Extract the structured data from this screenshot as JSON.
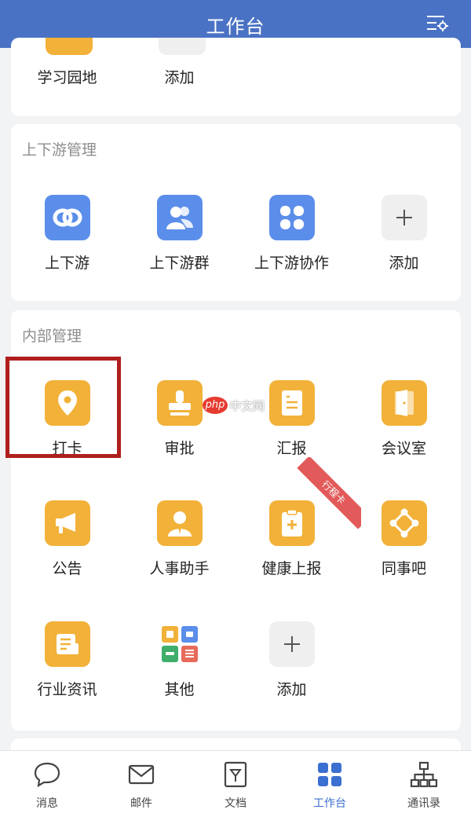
{
  "header": {
    "title": "工作台"
  },
  "top_section": {
    "items": [
      {
        "label": "学习园地"
      },
      {
        "label": "添加"
      }
    ]
  },
  "updown_section": {
    "title": "上下游管理",
    "items": [
      {
        "label": "上下游",
        "icon": "link-icon"
      },
      {
        "label": "上下游群",
        "icon": "group-icon"
      },
      {
        "label": "上下游协作",
        "icon": "grid-icon"
      },
      {
        "label": "添加",
        "icon": "plus-icon"
      }
    ]
  },
  "internal_section": {
    "title": "内部管理",
    "items": [
      {
        "label": "打卡",
        "icon": "location-pin-icon"
      },
      {
        "label": "审批",
        "icon": "stamp-icon"
      },
      {
        "label": "汇报",
        "icon": "report-icon"
      },
      {
        "label": "会议室",
        "icon": "door-icon"
      },
      {
        "label": "公告",
        "icon": "megaphone-icon"
      },
      {
        "label": "人事助手",
        "icon": "person-icon"
      },
      {
        "label": "健康上报",
        "icon": "clipboard-plus-icon",
        "ribbon": "行程卡"
      },
      {
        "label": "同事吧",
        "icon": "share-nodes-icon"
      },
      {
        "label": "行业资讯",
        "icon": "news-icon"
      },
      {
        "label": "其他",
        "icon": "others-icon"
      },
      {
        "label": "添加",
        "icon": "plus-icon"
      }
    ]
  },
  "watermark": {
    "php": "php",
    "text": "中文网"
  },
  "tabbar": {
    "tabs": [
      {
        "label": "消息",
        "icon": "chat-bubble-icon",
        "active": false
      },
      {
        "label": "邮件",
        "icon": "mail-icon",
        "active": false
      },
      {
        "label": "文档",
        "icon": "document-icon",
        "active": false
      },
      {
        "label": "工作台",
        "icon": "workbench-grid-icon",
        "active": true
      },
      {
        "label": "通讯录",
        "icon": "org-chart-icon",
        "active": false
      }
    ]
  },
  "colors": {
    "header": "#4a72c4",
    "blue_tile": "#5b8eea",
    "orange_tile": "#f2b138",
    "highlight_border": "#b01e1e",
    "active_tab": "#3b6fd0"
  }
}
